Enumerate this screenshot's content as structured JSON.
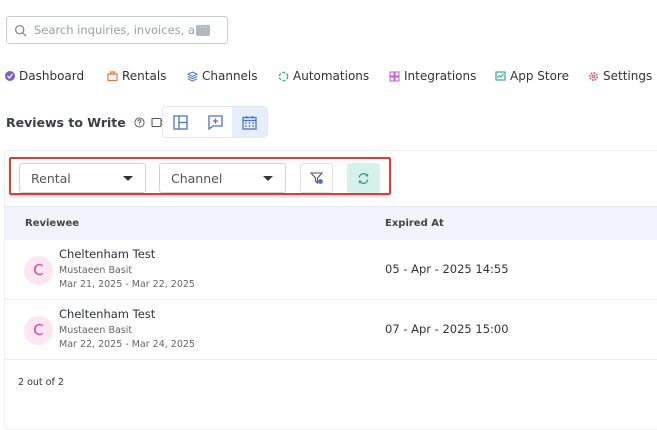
{
  "search": {
    "placeholder": "Search inquiries, invoices, an"
  },
  "nav": {
    "items": [
      {
        "label": "Dashboard",
        "icon": "dashboard-icon",
        "color": "#7b5cd6"
      },
      {
        "label": "Rentals",
        "icon": "rentals-icon",
        "color": "#e8743b"
      },
      {
        "label": "Channels",
        "icon": "channels-icon",
        "color": "#4a6fd6"
      },
      {
        "label": "Automations",
        "icon": "automations-icon",
        "color": "#3fb37f"
      },
      {
        "label": "Integrations",
        "icon": "integrations-icon",
        "color": "#c55ad6"
      },
      {
        "label": "App Store",
        "icon": "app-store-icon",
        "color": "#2ea38a"
      },
      {
        "label": "Settings",
        "icon": "settings-icon",
        "color": "#e0516b"
      }
    ]
  },
  "page": {
    "title": "Reviews to Write"
  },
  "filters": {
    "rental_label": "Rental",
    "channel_label": "Channel"
  },
  "table": {
    "headers": {
      "reviewee": "Reviewee",
      "expired_at": "Expired At"
    },
    "rows": [
      {
        "avatar": "C",
        "name": "Cheltenham Test",
        "owner": "Mustaeen Basit",
        "dates": "Mar 21, 2025 - Mar 22, 2025",
        "expired": "05 - Apr - 2025 14:55"
      },
      {
        "avatar": "C",
        "name": "Cheltenham Test",
        "owner": "Mustaeen Basit",
        "dates": "Mar 22, 2025 - Mar 24, 2025",
        "expired": "07 - Apr - 2025 15:00"
      }
    ],
    "count": "2 out of 2"
  },
  "colors": {
    "highlight_border": "#e2393d",
    "accent_green": "#2ea38a",
    "avatar_bg": "#fde6f3",
    "avatar_fg": "#e0448f"
  }
}
